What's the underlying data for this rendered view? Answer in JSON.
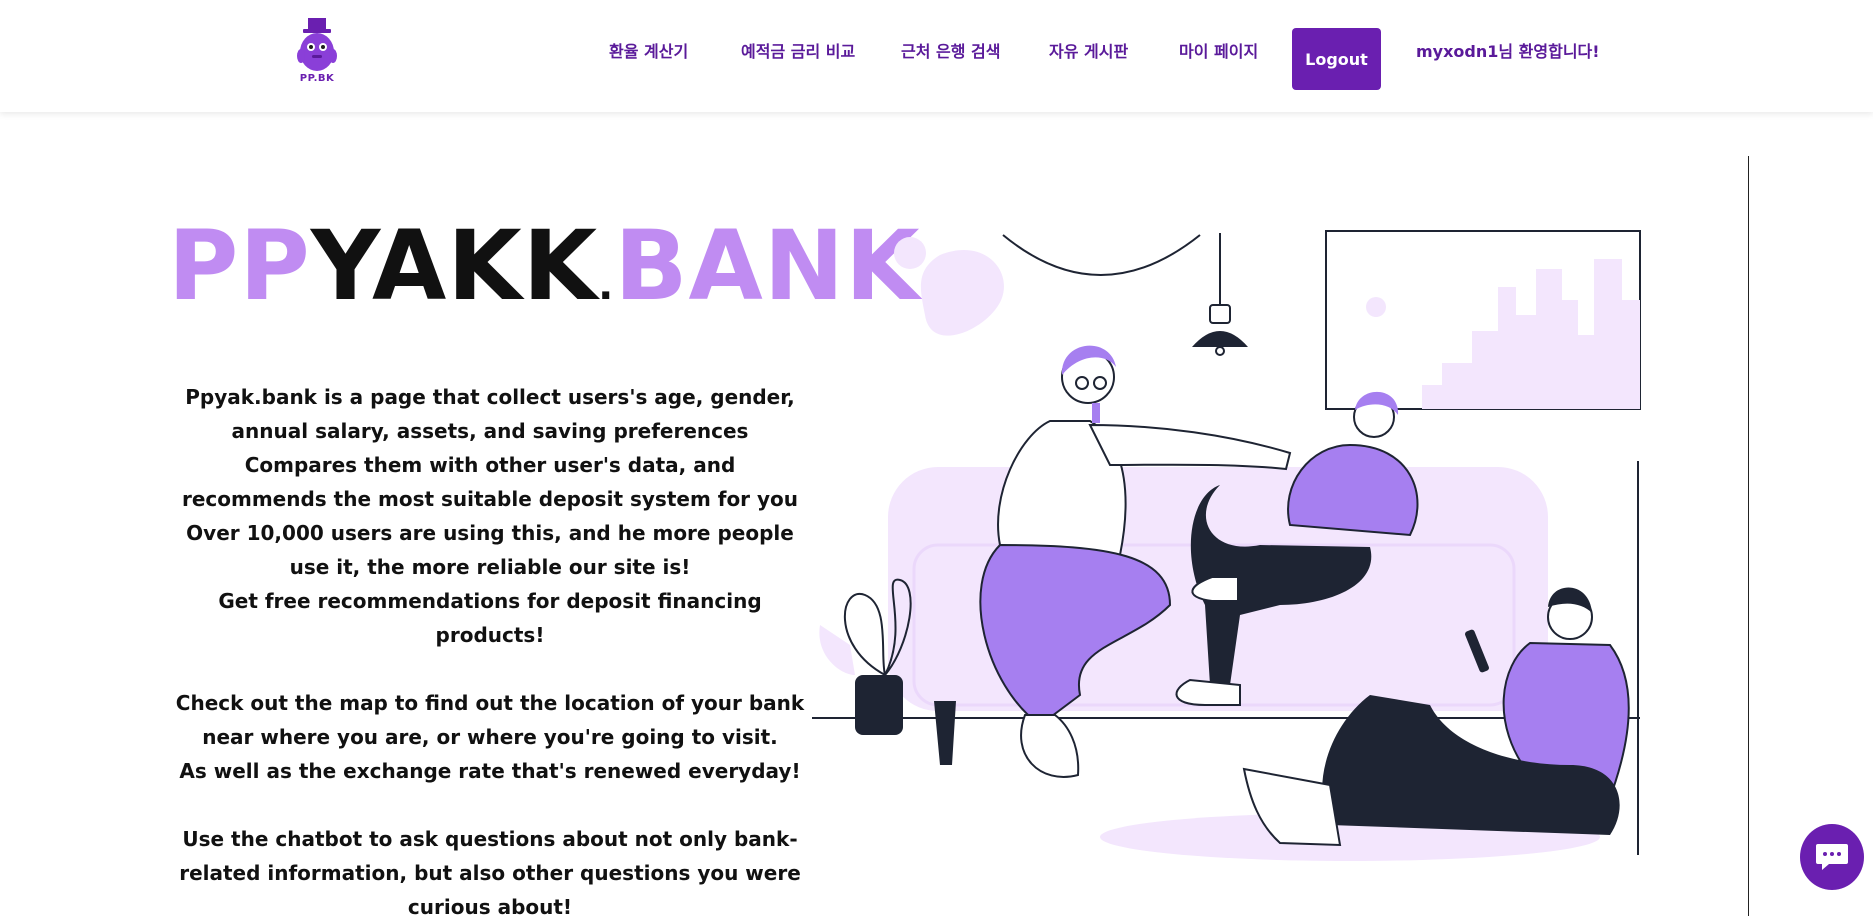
{
  "nav": {
    "logo_text": "PP.BK",
    "links": [
      "환율 계산기",
      "예적금 금리 비교",
      "근처 은행 검색",
      "자유 게시판",
      "마이 페이지"
    ],
    "logout_label": "Logout",
    "welcome": "myxodn1님 환영합니다!"
  },
  "hero": {
    "brand_parts": [
      "PP",
      "YAKK",
      ".",
      "BAN",
      "K"
    ],
    "paragraphs": [
      [
        "Ppyak.bank is a page that collect users's age, gender, annual salary, assets, and saving preferences",
        "Compares them with other user's data, and recommends the most suitable deposit system for you",
        "Over 10,000 users are using this, and he more people use it, the more reliable our site is!",
        "Get free recommendations for deposit financing products!"
      ],
      [
        "Check out the map to find out the location of your bank near where you are, or where you're going to visit.",
        "As well as the exchange rate that's renewed everyday!"
      ],
      [
        "Use the chatbot to ask questions about not only bank-related information, but also other questions you were curious about!"
      ]
    ]
  },
  "colors": {
    "accent": "#6a1fb0",
    "brand_light": "#c08cf2",
    "illustration_purple": "#a67ff0",
    "illustration_pale": "#f3e6fd",
    "ink": "#1e2433"
  },
  "icons": {
    "logo": "purple-mascot-top-hat",
    "chatbot": "chat-bubble-icon"
  }
}
